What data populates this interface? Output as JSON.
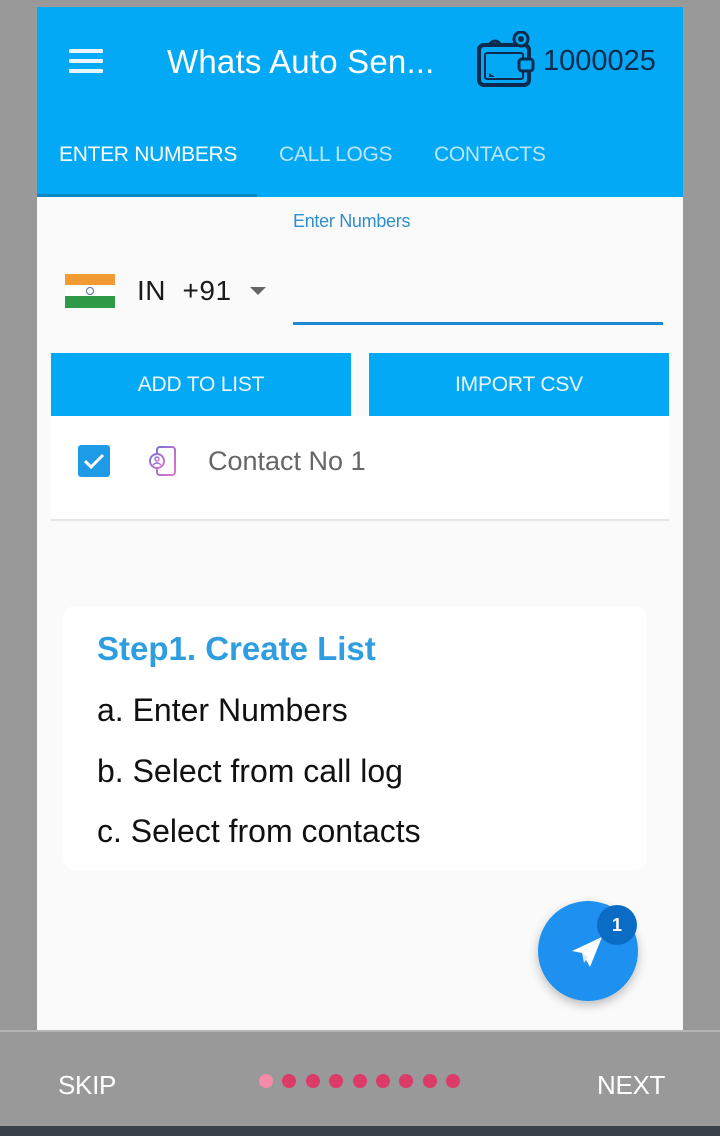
{
  "app": {
    "title": "Whats Auto Sen...",
    "wallet_icon": "wallet-icon",
    "balance": "1000025",
    "colors": {
      "primary": "#03a9f4",
      "accent": "#1e90f0",
      "dot": "#dc3a69",
      "dot_active": "#f38ba9"
    }
  },
  "tabs": [
    {
      "label": "ENTER NUMBERS",
      "active": true
    },
    {
      "label": "CALL LOGS",
      "active": false
    },
    {
      "label": "CONTACTS",
      "active": false
    }
  ],
  "entry": {
    "field_label": "Enter Numbers",
    "country_flag": "india-flag-icon",
    "country_code": "IN  +91",
    "number_value": "",
    "number_placeholder": ""
  },
  "buttons": {
    "add_to_list": "ADD TO LIST",
    "import_csv": "IMPORT CSV"
  },
  "contacts": [
    {
      "name": "Contact No 1",
      "checked": true,
      "icon": "contact-book-icon"
    }
  ],
  "info_card": {
    "title": "Step1. Create List",
    "lines": [
      "a. Enter Numbers",
      "b. Select from call log",
      "c. Select from contacts"
    ]
  },
  "fab": {
    "icon": "send-icon",
    "badge": "1"
  },
  "onboarding": {
    "skip_label": "SKIP",
    "next_label": "NEXT",
    "page_count": 9,
    "current_page": 1
  }
}
